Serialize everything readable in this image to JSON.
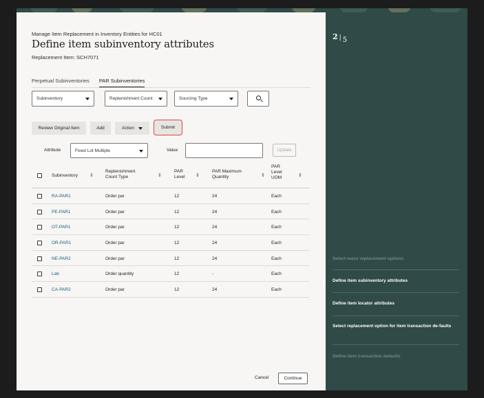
{
  "header": {
    "breadcrumb": "Manage Item Replacement in Inventory Entities for HC01",
    "title": "Define item subinventory attributes",
    "replacement_item": "Replacement Item: SCH7071"
  },
  "tabs": [
    {
      "label": "Perpetual Subinventories",
      "active": false
    },
    {
      "label": "PAR Subinventories",
      "active": true
    }
  ],
  "filters": {
    "subinventory": "Subinventory",
    "replenishment_count": "Replenishment Count",
    "sourcing_type": "Sourcing Type",
    "search_icon": "search-icon"
  },
  "toolbar": {
    "review": "Review Original Item",
    "add": "Add",
    "action": "Action",
    "submit": "Submit"
  },
  "attribute_bar": {
    "attribute_label": "Attribute",
    "attribute_value": "Fixed Lot Multiple",
    "value_label": "Value",
    "value_input": "",
    "update": "Update"
  },
  "table": {
    "columns": [
      "Subinventory",
      "Replenishment Count Type",
      "PAR Level",
      "PAR Maximum Quantity",
      "PAR Level UOM"
    ],
    "col_lines": {
      "replen": [
        "Replenishment",
        "Count Type"
      ],
      "par_level": [
        "PAR",
        "Level"
      ],
      "par_max": [
        "PAR Maximum",
        "Quantity"
      ],
      "uom": [
        "PAR",
        "Level",
        "UOM"
      ]
    },
    "rows": [
      {
        "sub": "RA-PAR1",
        "type": "Order par",
        "level": "12",
        "max": "24",
        "uom": "Each"
      },
      {
        "sub": "PE-PAR1",
        "type": "Order par",
        "level": "12",
        "max": "24",
        "uom": "Each"
      },
      {
        "sub": "OT-PAR1",
        "type": "Order par",
        "level": "12",
        "max": "24",
        "uom": "Each"
      },
      {
        "sub": "OR-PAR1",
        "type": "Order par",
        "level": "12",
        "max": "24",
        "uom": "Each"
      },
      {
        "sub": "NE-PAR2",
        "type": "Order par",
        "level": "12",
        "max": "24",
        "uom": "Each"
      },
      {
        "sub": "Lab",
        "type": "Order quantity",
        "level": "12",
        "max": "-",
        "uom": "Each"
      },
      {
        "sub": "CA-PAR2",
        "type": "Order par",
        "level": "12",
        "max": "24",
        "uom": "Each"
      }
    ]
  },
  "footer": {
    "cancel": "Cancel",
    "continue": "Continue"
  },
  "progress": {
    "current": "2",
    "separator": "|",
    "total": "5",
    "steps": [
      {
        "label": "Select mass replacement options",
        "state": "done"
      },
      {
        "label": "Define item subinventory attributes",
        "state": "current"
      },
      {
        "label": "Define item locator attributes",
        "state": "upcoming"
      },
      {
        "label": "Select replacement option for item transaction de-faults",
        "state": "upcoming"
      },
      {
        "label": "Define item transaction defaults",
        "state": "disabled"
      }
    ]
  },
  "colors": {
    "panel": "#2f4a47",
    "link": "#1e5a7a",
    "submit_highlight": "#e0443a"
  }
}
